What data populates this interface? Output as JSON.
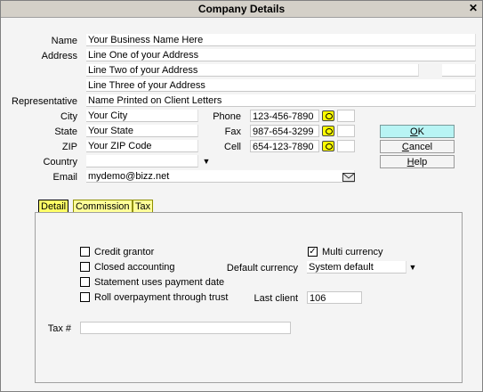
{
  "window": {
    "title": "Company Details",
    "close_symbol": "✕"
  },
  "form": {
    "name": {
      "label": "Name",
      "value": "Your Business Name Here"
    },
    "address": {
      "label": "Address",
      "line1": "Line One of your Address",
      "line2": "Line Two of your Address",
      "line3": "Line Three of your Address"
    },
    "representative": {
      "label": "Representative",
      "value": "Name Printed on Client Letters"
    },
    "city": {
      "label": "City",
      "value": "Your City"
    },
    "state": {
      "label": "State",
      "value": "Your State"
    },
    "zip": {
      "label": "ZIP",
      "value": "Your ZIP Code"
    },
    "country": {
      "label": "Country",
      "value": ""
    },
    "email": {
      "label": "Email",
      "value": "mydemo@bizz.net"
    },
    "phone": {
      "label": "Phone",
      "value": "123-456-7890",
      "ext": ""
    },
    "fax": {
      "label": "Fax",
      "value": "987-654-3299",
      "ext": ""
    },
    "cell": {
      "label": "Cell",
      "value": "654-123-7890",
      "ext": ""
    }
  },
  "buttons": {
    "ok": {
      "accel": "O",
      "rest": "K"
    },
    "cancel": {
      "accel": "C",
      "rest": "ancel"
    },
    "help": {
      "accel": "H",
      "rest": "elp"
    }
  },
  "tabs": [
    {
      "label": "Detail",
      "active": true
    },
    {
      "label": "Commission",
      "active": false
    },
    {
      "label": "Tax",
      "active": false
    }
  ],
  "detail": {
    "credit_grantor": {
      "label": "Credit grantor",
      "checked": false
    },
    "closed_accounting": {
      "label": "Closed accounting",
      "checked": false
    },
    "statement_payment_date": {
      "label": "Statement uses payment date",
      "checked": false
    },
    "roll_overpayment": {
      "label": "Roll overpayment through trust",
      "checked": false
    },
    "multi_currency": {
      "label": "Multi currency",
      "checked": true,
      "check_symbol": "✓"
    },
    "default_currency": {
      "label": "Default currency",
      "value": "System default"
    },
    "last_client": {
      "label": "Last client",
      "value": "106"
    },
    "tax_number": {
      "label": "Tax #",
      "value": ""
    }
  },
  "icons": {
    "dropdown_arrow": "▼"
  }
}
